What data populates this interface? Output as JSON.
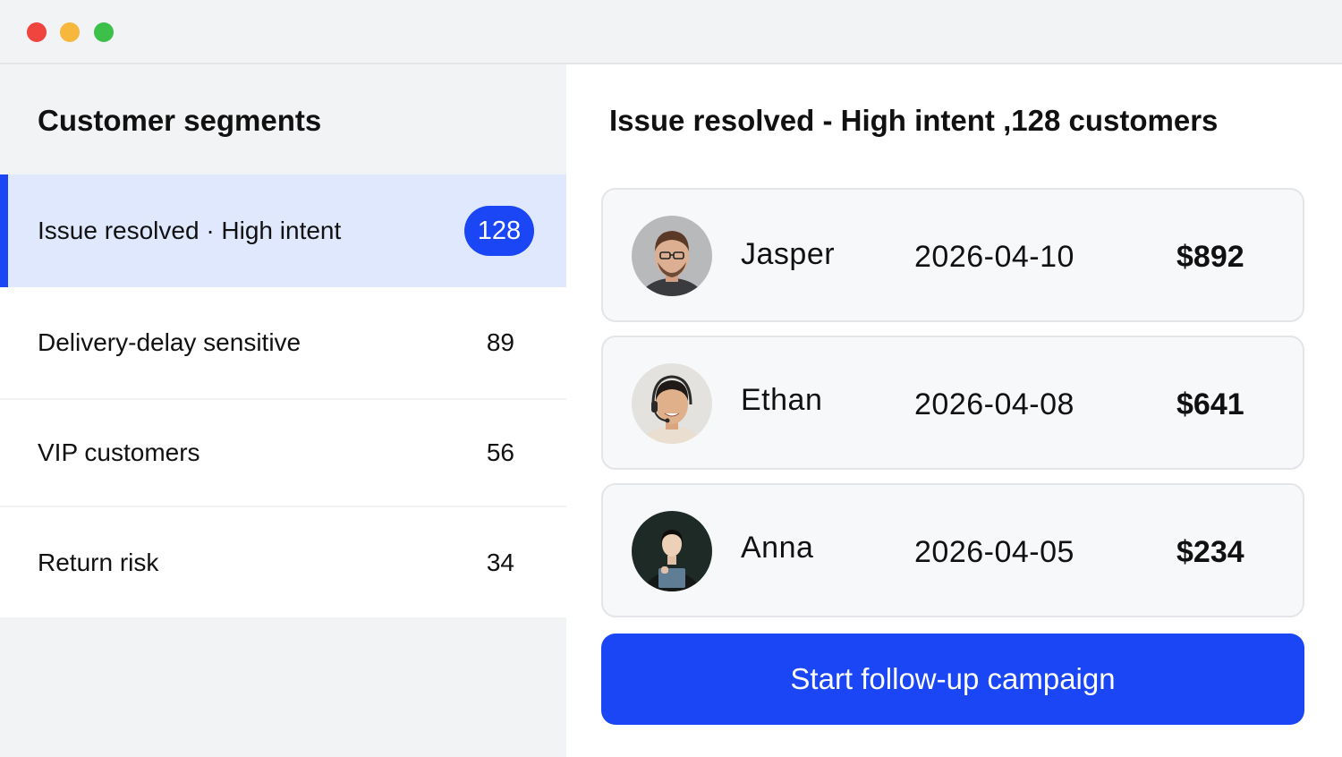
{
  "window": {
    "controls": [
      "close",
      "minimize",
      "maximize"
    ]
  },
  "sidebar": {
    "title": "Customer segments",
    "segments": [
      {
        "label": "Issue resolved · High intent",
        "count": "128",
        "selected": true
      },
      {
        "label": "Delivery-delay sensitive",
        "count": "89",
        "selected": false
      },
      {
        "label": "VIP customers",
        "count": "56",
        "selected": false
      },
      {
        "label": "Return risk",
        "count": "34",
        "selected": false
      }
    ]
  },
  "main": {
    "title": "Issue resolved - High intent ,128 customers",
    "customers": [
      {
        "name": "Jasper",
        "date": "2026-04-10",
        "amount": "$892",
        "avatar": "man-with-glasses-photo"
      },
      {
        "name": "Ethan",
        "date": "2026-04-08",
        "amount": "$641",
        "avatar": "man-with-headset-photo"
      },
      {
        "name": "Anna",
        "date": "2026-04-05",
        "amount": "$234",
        "avatar": "woman-with-laptop-photo"
      }
    ],
    "cta_label": "Start follow-up campaign"
  },
  "colors": {
    "accent": "#1a46f5",
    "selected_row": "#dfe8fd",
    "sidebar_bg": "#f2f3f5",
    "card_bg": "#f7f8fa"
  }
}
